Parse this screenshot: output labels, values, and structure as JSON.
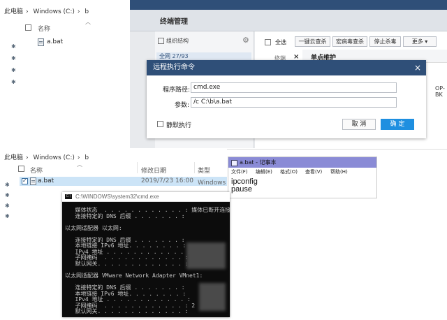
{
  "top_explorer": {
    "breadcrumb": [
      "此电脑",
      "Windows (C:)",
      "b"
    ],
    "col_name": "名称",
    "file": "a.bat"
  },
  "security_app": {
    "tab_title": "终端管理",
    "sidebar_title": "组织结构",
    "sidebar_count": "全网 27/93",
    "toolbar": {
      "select_all": "全选",
      "cloud_scan": "一键云查杀",
      "macro_scan": "宏病毒查杀",
      "stop_scan": "停止杀毒",
      "more": "更多"
    },
    "col_terminal": "终端",
    "col_single": "单点维护",
    "right_cut": "OP-BK"
  },
  "dialog": {
    "title": "远程执行命令",
    "path_label": "程序路径:",
    "path_value": "cmd.exe",
    "param_label": "参数:",
    "param_value": "/c  C:\\b\\a.bat",
    "silent_label": "静默执行",
    "cancel": "取 消",
    "ok": "确 定"
  },
  "bottom_explorer": {
    "breadcrumb": [
      "此电脑",
      "Windows (C:)",
      "b"
    ],
    "col_name": "名称",
    "col_date": "修改日期",
    "col_type": "类型",
    "file_name": "a.bat",
    "file_date": "2019/7/23 16:00",
    "file_type": "Windows 批"
  },
  "notepad": {
    "title": "a.bat - 记事本",
    "menu": [
      "文件(F)",
      "编辑(E)",
      "格式(O)",
      "查看(V)",
      "帮助(H)"
    ],
    "lines": [
      "ipconfig",
      "pause"
    ]
  },
  "cmd": {
    "title": "C:\\WINDOWS\\system32\\cmd.exe",
    "lines": [
      "   媒体状态  . . . . . . . . . . . . : 媒体已断开连接",
      "   连接特定的 DNS 后缀 . . . . . . . :",
      "",
      "以太网适配器 以太网:",
      "",
      "   连接特定的 DNS 后缀 . . . . . . . :",
      "   本地链接 IPv6 地址. . . . . . . . :",
      "   IPv4 地址 . . . . . . . . . . . . :",
      "   子网掩码  . . . . . . . . . . . . :",
      "   默认网关. . . . . . . . . . . . . :",
      "",
      "以太网适配器 VMware Network Adapter VMnet1:",
      "",
      "   连接特定的 DNS 后缀 . . . . . . . :",
      "   本地链接 IPv6 地址. . . . . . . . :",
      "   IPv4 地址 . . . . . . . . . . . . :",
      "   子网掩码  . . . . . . . . . . . . : 2",
      "   默认网关. . . . . . . . . . . . . :"
    ]
  }
}
